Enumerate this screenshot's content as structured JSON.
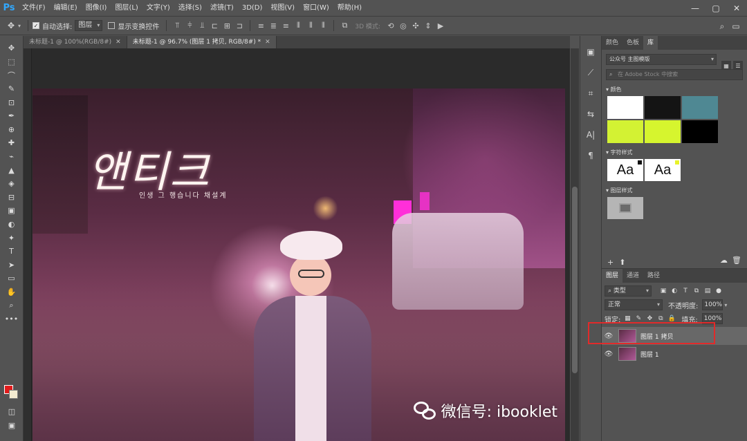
{
  "app": {
    "logo": "Ps"
  },
  "menu": [
    "文件(F)",
    "编辑(E)",
    "图像(I)",
    "图层(L)",
    "文字(Y)",
    "选择(S)",
    "滤镜(T)",
    "3D(D)",
    "视图(V)",
    "窗口(W)",
    "帮助(H)"
  ],
  "window_controls": {
    "minimize": "—",
    "maximize": "▢",
    "close": "✕"
  },
  "options_bar": {
    "auto_select_label": "自动选择:",
    "auto_select_value": "图层",
    "show_transform_label": "显示变换控件",
    "mode_3d_label": "3D 模式:"
  },
  "tabs": [
    {
      "label": "未标题-1 @ 100%(RGB/8#)",
      "active": false
    },
    {
      "label": "未标题-1 @ 96.7% (图层 1 拷贝, RGB/8#) *",
      "active": true
    }
  ],
  "tools": [
    "✥",
    "⬚",
    "⌒",
    "✎",
    "⊡",
    "✒",
    "⊕",
    "✚",
    "⌁",
    "▲",
    "◈",
    "⊟",
    "▣",
    "◐",
    "✦",
    "T",
    "➤",
    "▭",
    "✋",
    "⌕",
    "•••"
  ],
  "canvas": {
    "korean_title": "앤티크",
    "korean_sub": "인생 그 행습니다 채설계",
    "watermark_text": "微信号: ibooklet"
  },
  "iconstrip": [
    "▣",
    "⟋",
    "⌗",
    "⇆",
    "A|",
    "¶"
  ],
  "library_panel": {
    "tabs": [
      {
        "label": "颜色",
        "active": false
      },
      {
        "label": "色板",
        "active": false
      },
      {
        "label": "库",
        "active": true
      }
    ],
    "library_name": "公众号 主图模版",
    "search_placeholder": "在 Adobe Stock 中搜索",
    "colors_heading": "▾ 颜色",
    "colors": [
      "#ffffff",
      "#141414",
      "#4f8893",
      "#d3f233",
      "#d6f52e",
      "#000000"
    ],
    "char_styles_heading": "▾ 字符样式",
    "char_styles": [
      {
        "text": "Aa",
        "chip": "#111111"
      },
      {
        "text": "Aa",
        "chip": "#e8f32a"
      }
    ],
    "layer_styles_heading": "▾ 图层样式"
  },
  "layers_panel": {
    "tabs": [
      {
        "label": "图层",
        "active": true
      },
      {
        "label": "通道",
        "active": false
      },
      {
        "label": "路径",
        "active": false
      }
    ],
    "filter_value": "类型",
    "blend_mode": "正常",
    "opacity_label": "不透明度:",
    "opacity_value": "100%",
    "lock_label": "锁定:",
    "fill_label": "填充:",
    "fill_value": "100%",
    "layers": [
      {
        "name": "图层 1 拷贝",
        "selected": true
      },
      {
        "name": "图层 1",
        "selected": false
      }
    ]
  }
}
